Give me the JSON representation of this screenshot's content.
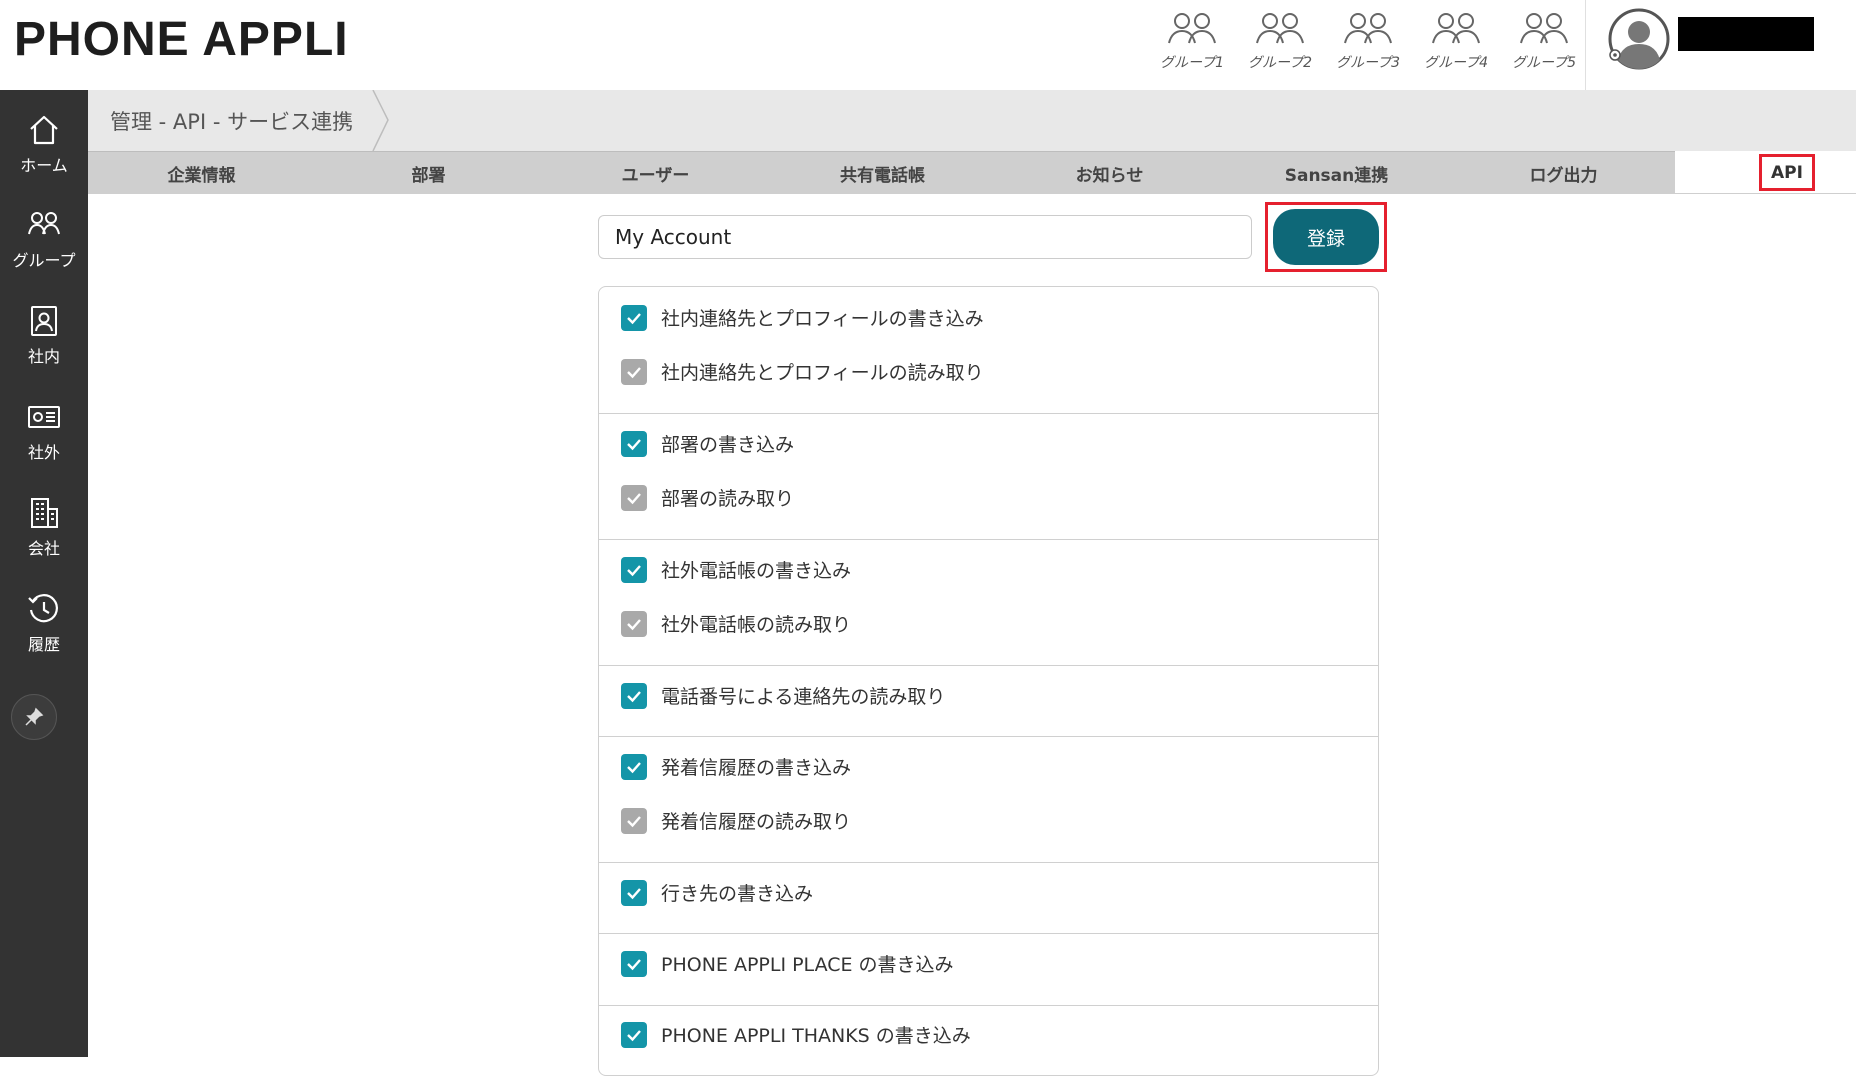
{
  "header": {
    "logo": "PHONE APPLI",
    "groups": [
      "グループ1",
      "グループ2",
      "グループ3",
      "グループ4",
      "グループ5"
    ]
  },
  "sidebar": {
    "items": [
      {
        "label": "ホーム",
        "icon": "home-icon"
      },
      {
        "label": "グループ",
        "icon": "group-icon"
      },
      {
        "label": "社内",
        "icon": "contact-book-icon"
      },
      {
        "label": "社外",
        "icon": "id-card-icon"
      },
      {
        "label": "会社",
        "icon": "building-icon"
      },
      {
        "label": "履歴",
        "icon": "history-icon"
      }
    ],
    "pin_icon": "pin-icon"
  },
  "breadcrumb": "管理 - API - サービス連携",
  "tabs": [
    "企業情報",
    "部署",
    "ユーザー",
    "共有電話帳",
    "お知らせ",
    "Sansan連携",
    "ログ出力",
    "API"
  ],
  "form": {
    "name_value": "My Account",
    "register_label": "登録"
  },
  "permissions": [
    {
      "label": "社内連絡先とプロフィールの書き込み",
      "checked": true
    },
    {
      "label": "社内連絡先とプロフィールの読み取り",
      "checked": false
    },
    {
      "label": "部署の書き込み",
      "checked": true
    },
    {
      "label": "部署の読み取り",
      "checked": false
    },
    {
      "label": "社外電話帳の書き込み",
      "checked": true
    },
    {
      "label": "社外電話帳の読み取り",
      "checked": false
    },
    {
      "label": "電話番号による連絡先の読み取り",
      "checked": true
    },
    {
      "label": "発着信履歴の書き込み",
      "checked": true
    },
    {
      "label": "発着信履歴の読み取り",
      "checked": false
    },
    {
      "label": "行き先の書き込み",
      "checked": true
    },
    {
      "label": "PHONE APPLI PLACE の書き込み",
      "checked": true
    },
    {
      "label": "PHONE APPLI THANKS の書き込み",
      "checked": true
    }
  ],
  "colors": {
    "accent": "#0e6878",
    "checkbox_on": "#1495a8",
    "checkbox_off": "#a9a9a9",
    "highlight": "#e5202e",
    "sidebar": "#333333"
  }
}
